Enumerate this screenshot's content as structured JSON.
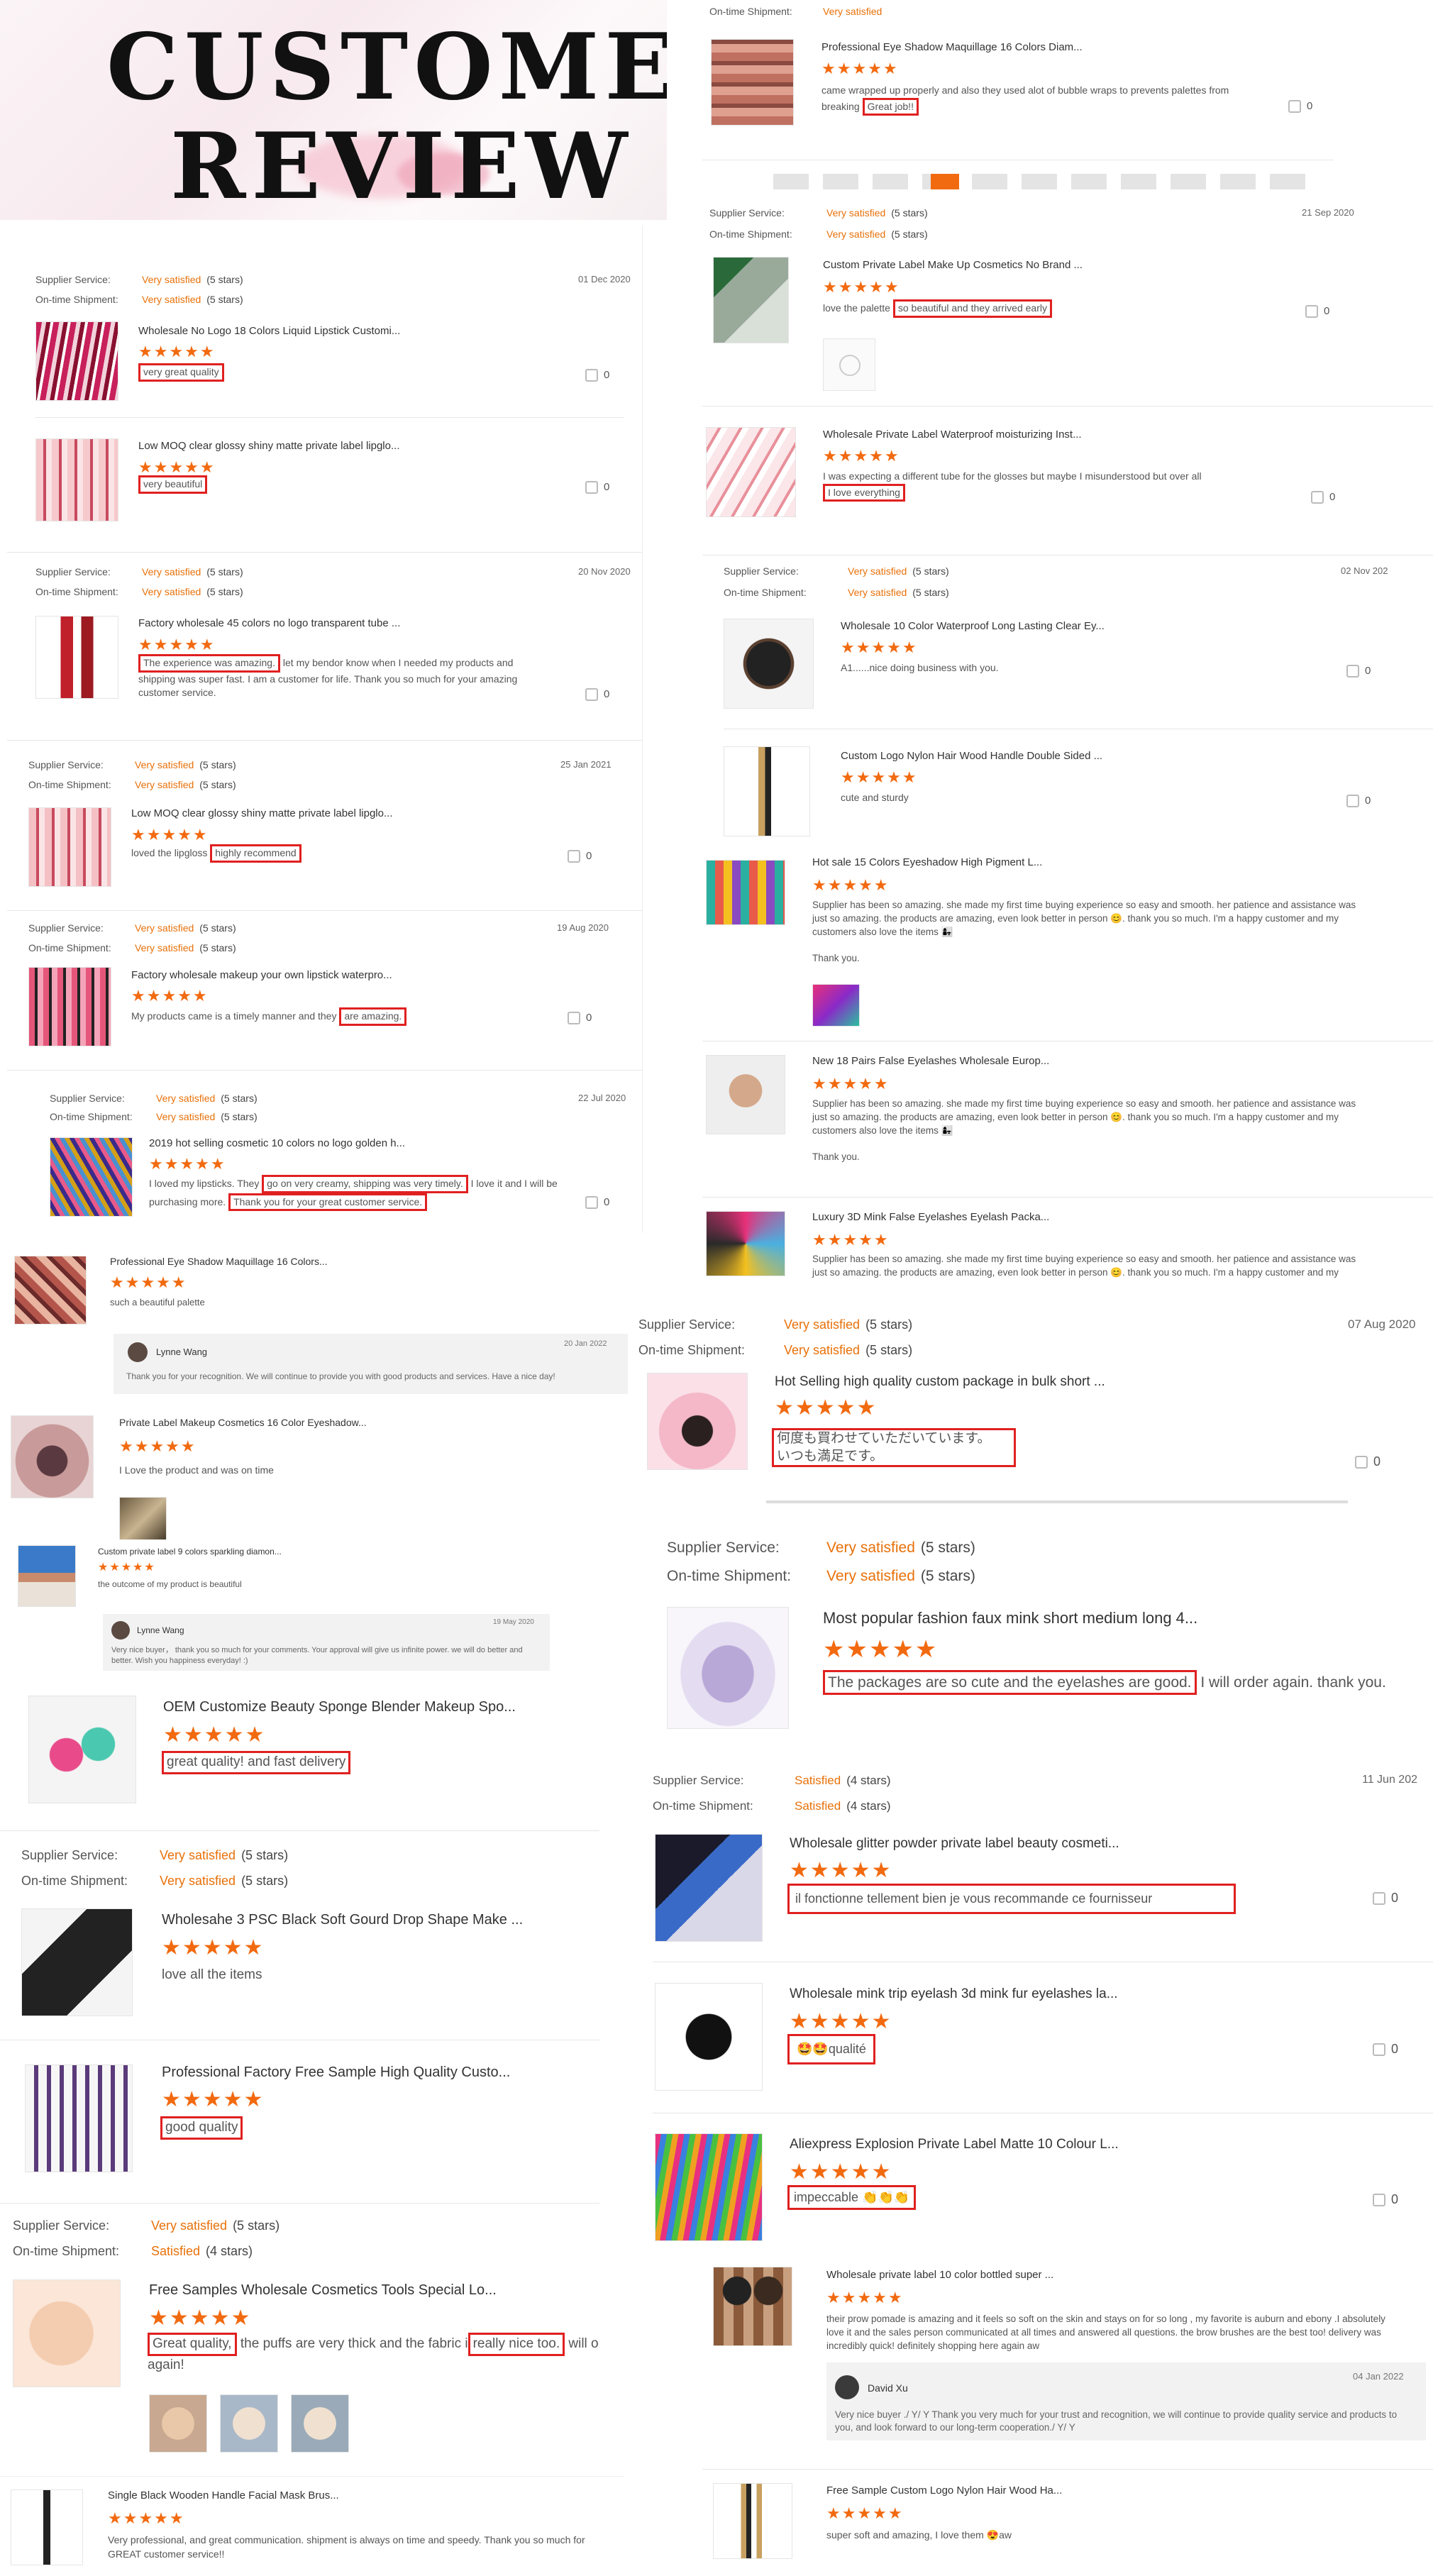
{
  "banner": {
    "line1": "CUSTOMER",
    "line2": "REVIEW"
  },
  "labels": {
    "supplier": "Supplier Service:",
    "ontime": "On-time Shipment:",
    "v_sat": "Very satisfied",
    "sat": "Satisfied",
    "five": "(5 stars)",
    "four": "(4 stars)",
    "stars5": "★★★★★"
  },
  "reviews": {
    "r1": {
      "date": "01 Dec 2020",
      "title": "Wholesale No Logo 18 Colors Liquid Lipstick Customi...",
      "comment": "very great quality",
      "likes": "0"
    },
    "r2": {
      "title": "Low MOQ clear glossy shiny matte private label lipglo...",
      "comment": "very beautiful",
      "likes": "0"
    },
    "r3": {
      "date": "20 Nov 2020",
      "title": "Factory wholesale 45 colors no logo transparent tube ...",
      "comment_hl": "The experience was amazing.",
      "comment_rest": " let my bendor know when I needed my products and shipping was super fast. I am a customer for life. Thank you so much for your amazing customer service.",
      "likes": "0"
    },
    "r4": {
      "date": "25 Jan 2021",
      "title": "Low MOQ clear glossy shiny matte private label lipglo...",
      "comment_pre": "loved the lipgloss ",
      "comment_hl": "highly recommend",
      "likes": "0"
    },
    "r5": {
      "date": "19 Aug 2020",
      "title": "Factory wholesale makeup your own lipstick waterpro...",
      "comment_pre": "My products came is a timely manner and they ",
      "comment_hl": "are amazing.",
      "likes": "0"
    },
    "r6": {
      "date": "22 Jul 2020",
      "title": "2019 hot selling cosmetic 10 colors no logo golden h...",
      "comment_pre": "I loved my lipsticks. They ",
      "comment_hl": "go on very creamy, shipping was very timely.",
      "comment_mid": " I love it and I will be purchasing more. ",
      "comment_hl2": "Thank you for your great customer service.",
      "likes": "0"
    },
    "r7": {
      "title": "Professional Eye Shadow Maquillage 16 Colors...",
      "comment": "such a beautiful palette",
      "reply_name": "Lynne Wang",
      "reply_date": "20 Jan 2022",
      "reply_text": "Thank you for your recognition. We will continue to provide you with good products and services. Have a nice day!"
    },
    "r8": {
      "title": "Private Label Makeup Cosmetics 16 Color Eyeshadow...",
      "comment": "I Love the product and was on time"
    },
    "r9": {
      "title": "Custom private label 9 colors sparkling diamon...",
      "comment": "the outcome of my product is beautiful",
      "reply_name": "Lynne Wang",
      "reply_date": "19 May 2020",
      "reply_text": "Very nice buyer， thank you so much for your comments. Your approval will give us infinite power. we will do better and better.  Wish you happiness everyday!  :)"
    },
    "r10": {
      "title": "OEM Customize Beauty Sponge Blender Makeup Spo...",
      "comment": "great quality! and fast delivery"
    },
    "r11": {
      "title": "Wholesahe 3 PSC Black Soft Gourd Drop Shape Make ...",
      "comment": "love all the items"
    },
    "r12": {
      "title": "Professional Factory Free Sample High Quality Custo...",
      "comment": "good quality"
    },
    "r13": {
      "title": "Free Samples Wholesale Cosmetics Tools Special Lo...",
      "comment_hl": "Great quality,",
      "comment_mid": " the puffs are very thick and the fabric i",
      "comment_hl2": "really nice too.",
      "comment_rest": " will order these again!"
    },
    "r14": {
      "title": "Single Black Wooden Handle Facial Mask Brus...",
      "comment": "Very professional, and great communication. shipment is always on time and speedy. Thank you so much for GREAT customer service!!"
    },
    "r15": {
      "title": "Professional Eye Shadow Maquillage 16 Colors Diam...",
      "comment_pre": "came wrapped up properly and also they used alot of bubble wraps to prevents palettes from breaking ",
      "comment_hl": "Great job!!",
      "likes": "0"
    },
    "r16": {
      "date": "21 Sep 2020",
      "title": "Custom Private Label Make Up Cosmetics No Brand ...",
      "comment_pre": "love the palette ",
      "comment_hl": "so beautiful and they arrived early",
      "likes": "0"
    },
    "r17": {
      "title": "Wholesale Private Label Waterproof moisturizing Inst...",
      "comment_pre": "I was expecting a different tube for the glosses but maybe I misunderstood but over all ",
      "comment_hl": "I love everything",
      "likes": "0"
    },
    "r18": {
      "date": "02 Nov 202",
      "title": "Wholesale 10 Color Waterproof Long Lasting Clear Ey...",
      "comment": "A1......nice doing business with you.",
      "likes": "0"
    },
    "r19": {
      "title": "Custom Logo Nylon Hair Wood Handle Double Sided ...",
      "comment": "cute and sturdy",
      "likes": "0"
    },
    "r20": {
      "title": "Hot sale 15 Colors Eyeshadow High Pigment L...",
      "comment": "Supplier has been so amazing. she made my first time buying experience so easy and smooth. her patience and assistance was just so amazing. the products are amazing, even look better in person 😊. thank you so much. I'm a happy customer and my customers also love the items 👩‍👧",
      "thanks": "Thank you."
    },
    "r21": {
      "title": "New 18 Pairs False Eyelashes Wholesale Europ...",
      "comment": "Supplier has been so amazing. she made my first time buying experience so easy and smooth. her patience and assistance was just so amazing. the products are amazing, even look better in person 😊. thank you so much. I'm a happy customer and my customers also love the items 👩‍👧",
      "thanks": "Thank you."
    },
    "r22": {
      "title": "Luxury 3D Mink False Eyelashes Eyelash Packa...",
      "comment": "Supplier has been so amazing. she made my first time buying experience so easy and smooth. her patience and assistance was just so amazing. the products are amazing, even look better in person 😊. thank you so much. I'm a happy customer and my customers also love the items 👩‍👧"
    },
    "r23": {
      "date": "07 Aug 2020",
      "title": "Hot Selling high quality custom package in bulk short ...",
      "comment_l1": "何度も買わせていただいています。",
      "comment_l2": "いつも満足です。",
      "likes": "0"
    },
    "r24": {
      "title": "Most popular fashion faux mink short medium long 4...",
      "comment_hl": "The packages are so cute and the eyelashes are good.",
      "comment_rest": " I will order again. thank you."
    },
    "r25": {
      "date": "11 Jun 202",
      "title": "Wholesale glitter powder private label beauty cosmeti...",
      "comment": "il fonctionne tellement bien je vous recommande ce fournisseur",
      "likes": "0"
    },
    "r26": {
      "title": "Wholesale mink trip eyelash 3d mink fur eyelashes la...",
      "comment": "🤩🤩qualité",
      "likes": "0"
    },
    "r27": {
      "title": "Aliexpress Explosion Private Label Matte 10 Colour L...",
      "comment": "impeccable 👏👏👏",
      "likes": "0"
    },
    "r28": {
      "title": "Wholesale private label 10 color bottled super ...",
      "comment": "their prow pomade is amazing and it feels so soft on the skin and stays on for so long , my favorite is auburn and ebony .I absolutely love it and the sales person communicated at all times and answered all questions. the brow brushes are the best too! delivery was incredibly quick! definitely shopping here again aw",
      "reply_name": "David Xu",
      "reply_date": "04 Jan 2022",
      "reply_text": "Very nice buyer ./ Y/ Y Thank you very much for your trust and recognition, we will continue to provide quality service and products to you, and look forward to our long-term cooperation./ Y/ Y"
    },
    "r29": {
      "title": "Free Sample Custom Logo Nylon Hair Wood Ha...",
      "comment": "super soft and amazing, I love them 😍aw"
    }
  },
  "colors": {
    "accent": "#f26a10",
    "highlight": "#e02020",
    "orange_text": "#e8710a"
  }
}
